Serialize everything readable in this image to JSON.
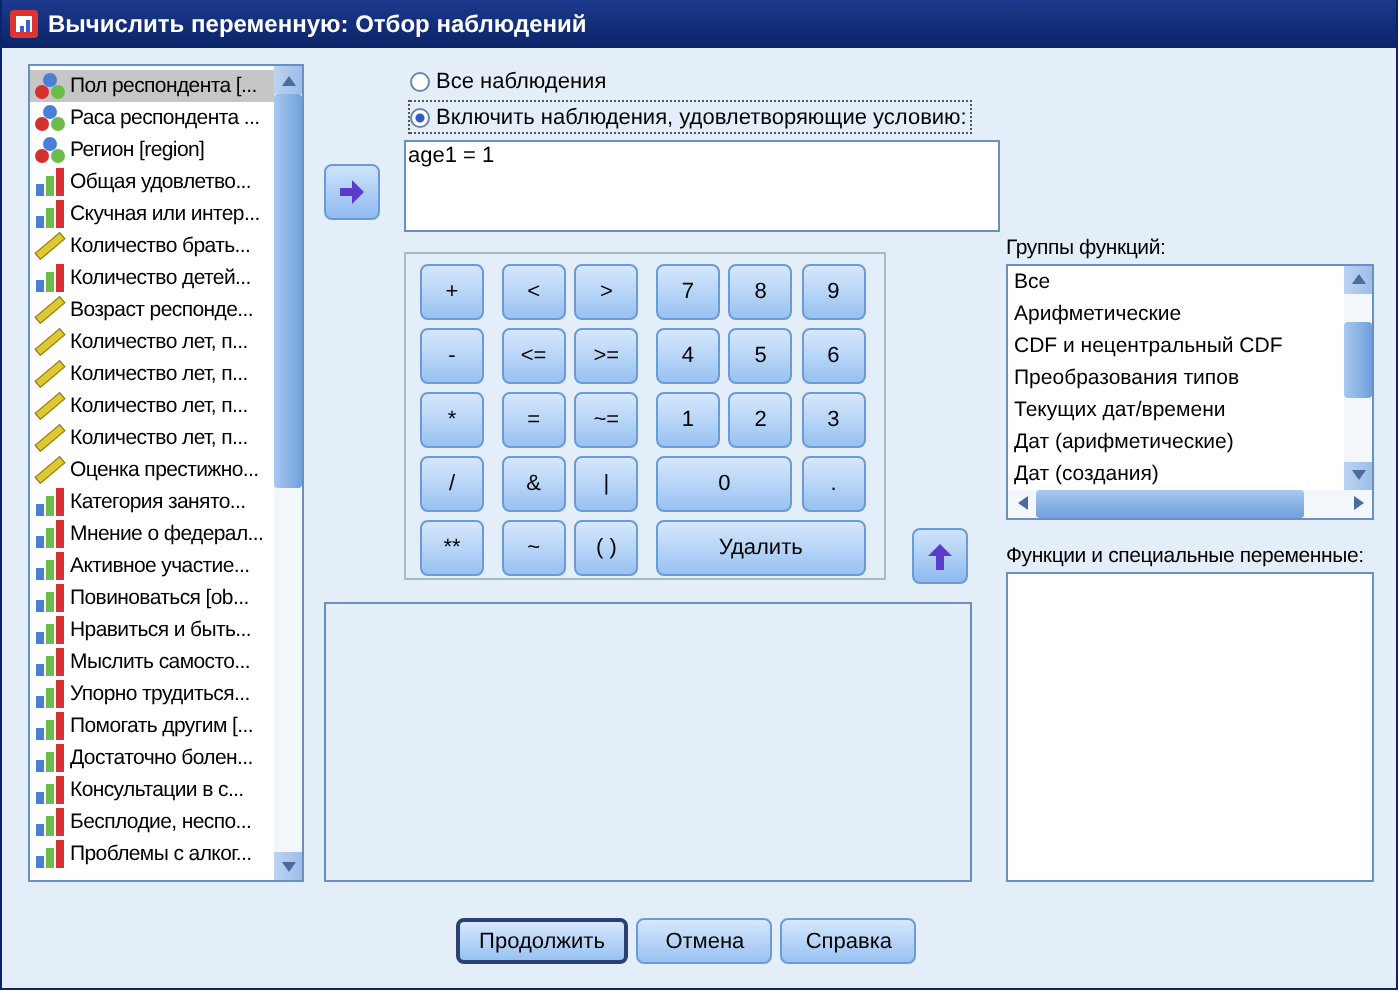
{
  "window": {
    "title": "Вычислить переменную: Отбор наблюдений"
  },
  "variables": [
    {
      "name": "Пол респондента [...",
      "kind": "nominal",
      "selected": true
    },
    {
      "name": "Раса респондента ...",
      "kind": "nominal",
      "selected": false
    },
    {
      "name": "Регион [region]",
      "kind": "nominal",
      "selected": false
    },
    {
      "name": "Общая удовлетво...",
      "kind": "ordinal",
      "selected": false
    },
    {
      "name": "Скучная или интер...",
      "kind": "ordinal",
      "selected": false
    },
    {
      "name": "Количество брать...",
      "kind": "scale",
      "selected": false
    },
    {
      "name": "Количество детей...",
      "kind": "ordinal",
      "selected": false
    },
    {
      "name": "Возраст респонде...",
      "kind": "scale",
      "selected": false
    },
    {
      "name": "Количество лет, п...",
      "kind": "scale",
      "selected": false
    },
    {
      "name": "Количество лет, п...",
      "kind": "scale",
      "selected": false
    },
    {
      "name": "Количество лет, п...",
      "kind": "scale",
      "selected": false
    },
    {
      "name": "Количество лет, п...",
      "kind": "scale",
      "selected": false
    },
    {
      "name": "Оценка престижно...",
      "kind": "scale",
      "selected": false
    },
    {
      "name": "Категория занято...",
      "kind": "ordinal",
      "selected": false
    },
    {
      "name": "Мнение о федерал...",
      "kind": "ordinal",
      "selected": false
    },
    {
      "name": "Активное участие...",
      "kind": "ordinal",
      "selected": false
    },
    {
      "name": "Повиноваться [ob...",
      "kind": "ordinal",
      "selected": false
    },
    {
      "name": "Нравиться и быть...",
      "kind": "ordinal",
      "selected": false
    },
    {
      "name": "Мыслить самосто...",
      "kind": "ordinal",
      "selected": false
    },
    {
      "name": "Упорно трудиться...",
      "kind": "ordinal",
      "selected": false
    },
    {
      "name": "Помогать другим [...",
      "kind": "ordinal",
      "selected": false
    },
    {
      "name": "Достаточно болен...",
      "kind": "ordinal",
      "selected": false
    },
    {
      "name": "Консультации в с...",
      "kind": "ordinal",
      "selected": false
    },
    {
      "name": "Бесплодие, неспо...",
      "kind": "ordinal",
      "selected": false
    },
    {
      "name": "Проблемы с алког...",
      "kind": "ordinal",
      "selected": false
    }
  ],
  "options": [
    {
      "label": "Все наблюдения",
      "selected": false
    },
    {
      "label": "Включить наблюдения, удовлетворяющие условию:",
      "selected": true
    }
  ],
  "expression": {
    "value": "age1 = 1"
  },
  "keypad": [
    [
      {
        "label": "+",
        "kind": "key"
      },
      {
        "label": "<",
        "kind": "key"
      },
      {
        "label": ">",
        "kind": "key"
      },
      {
        "label": "7",
        "kind": "key"
      },
      {
        "label": "8",
        "kind": "key"
      },
      {
        "label": "9",
        "kind": "key"
      }
    ],
    [
      {
        "label": "-",
        "kind": "key"
      },
      {
        "label": "<=",
        "kind": "key"
      },
      {
        "label": ">=",
        "kind": "key"
      },
      {
        "label": "4",
        "kind": "key"
      },
      {
        "label": "5",
        "kind": "key"
      },
      {
        "label": "6",
        "kind": "key"
      }
    ],
    [
      {
        "label": "*",
        "kind": "key"
      },
      {
        "label": "=",
        "kind": "key"
      },
      {
        "label": "~=",
        "kind": "key"
      },
      {
        "label": "1",
        "kind": "key"
      },
      {
        "label": "2",
        "kind": "key"
      },
      {
        "label": "3",
        "kind": "key"
      }
    ],
    [
      {
        "label": "/",
        "kind": "key"
      },
      {
        "label": "&",
        "kind": "key"
      },
      {
        "label": "|",
        "kind": "key"
      },
      {
        "label": "0",
        "kind": "wide"
      },
      {
        "label": ".",
        "kind": "key"
      }
    ],
    [
      {
        "label": "**",
        "kind": "key"
      },
      {
        "label": "~",
        "kind": "key"
      },
      {
        "label": "( )",
        "kind": "key"
      },
      {
        "label": "Удалить",
        "kind": "wide"
      }
    ]
  ],
  "function_groups": {
    "label": "Группы функций:",
    "items": [
      "Все",
      "Арифметические",
      "CDF и нецентральный CDF",
      "Преобразования типов",
      "Текущих дат/времени",
      "Дат (арифметические)",
      "Дат (создания)"
    ]
  },
  "functions": {
    "label": "Функции и специальные переменные:"
  },
  "buttons": [
    {
      "label": "Продолжить",
      "selected": true
    },
    {
      "label": "Отмена",
      "selected": false
    },
    {
      "label": "Справка",
      "selected": false
    }
  ]
}
